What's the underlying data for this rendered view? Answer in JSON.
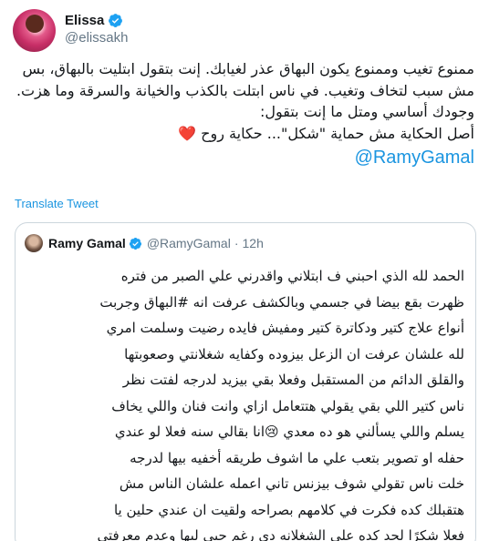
{
  "author": {
    "display_name": "Elissa",
    "handle": "@elissakh",
    "verified": true,
    "avatar_icon": "profile-photo"
  },
  "tweet": {
    "lines": [
      "ممنوع تغيب وممنوع يكون البهاق عذر لغيابك. إنت بتقول ابتليت بالبهاق، بس",
      "مش سبب لتخاف وتغيب. في ناس ابتلت بالكذب والخيانة والسرقة وما هزت.",
      "وجودك أساسي ومتل ما إنت بتقول:",
      "أصل الحكاية مش حماية \"شكل\"... حكاية روح"
    ],
    "heart_emoji": "❤️",
    "mention": "@RamyGamal"
  },
  "translate_label": "Translate Tweet",
  "quoted": {
    "display_name": "Ramy Gamal",
    "handle": "@RamyGamal",
    "separator": "·",
    "time": "12h",
    "verified": true,
    "lines": [
      "الحمد لله الذي احبني ف ابتلاني واقدرني علي الصبر من فتره",
      "ظهرت بقع بيضا في جسمي وبالكشف عرفت انه #البهاق وجربت",
      "أنواع علاج كتير ودكاترة كتير ومفيش فايده رضيت وسلمت امري",
      "لله علشان عرفت ان الزعل بيزوده وكفايه شغلانتي وصعوبتها",
      "والقلق الدائم من المستقبل وفعلا بقي بيزيد لدرجه لفتت نظر",
      "ناس كتير اللي بقي  يقولي هتتعامل ازاي وانت فنان واللي يخاف",
      "يسلم واللي يسألني هو ده معدي 😢انا بقالي سنه فعلا لو عندي",
      "حفله او تصوير بتعب علي ما اشوف طريقه أخفيه بيها  لدرجه",
      "خلت ناس تقولي شوف بيزنس تاني اعمله علشان الناس مش",
      "هتقبلك كده فكرت في كلامهم بصراحه ولقيت ان  عندي حلين يا",
      "فعلا شكرًا لحد كده علي الشغلانه دي رغم حبي ليها وعدم معرفتي"
    ]
  },
  "colors": {
    "link": "#1b95e0",
    "verified": "#1da1f2",
    "secondary_text": "#657786",
    "border": "#ccd6dd",
    "heart": "#e0245e"
  }
}
